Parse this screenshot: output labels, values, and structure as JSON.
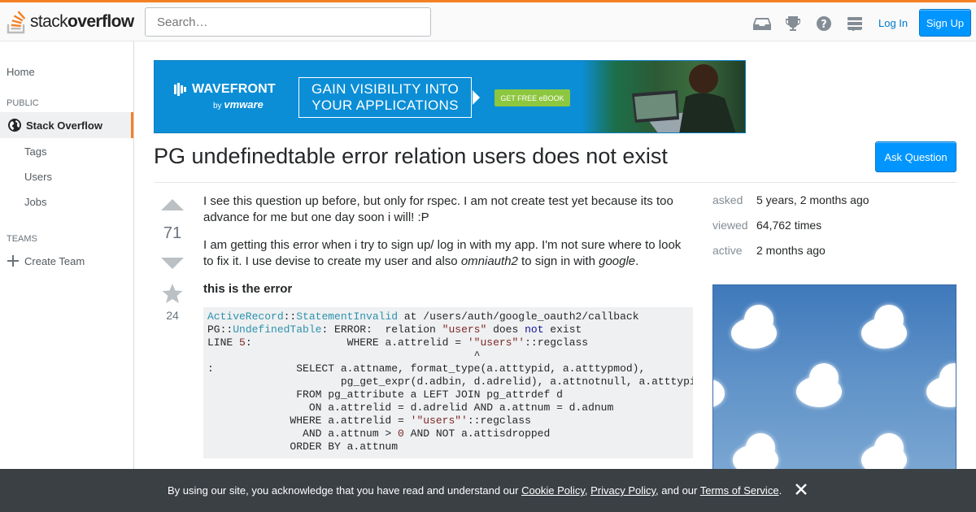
{
  "header": {
    "logo_prefix": "stack",
    "logo_suffix": "overflow",
    "search_placeholder": "Search…",
    "icons": [
      "inbox-icon",
      "trophy-icon",
      "help-icon",
      "stack-exchange-icon"
    ],
    "login_label": "Log In",
    "signup_label": "Sign Up",
    "accent_color": "#f48024",
    "button_color": "#0095ff"
  },
  "sidebar": {
    "home": "Home",
    "public_heading": "PUBLIC",
    "active_item": "Stack Overflow",
    "items": [
      {
        "label": "Tags"
      },
      {
        "label": "Users"
      },
      {
        "label": "Jobs"
      }
    ],
    "teams_heading": "TEAMS",
    "create_team": "Create Team"
  },
  "ad_banner": {
    "brand": "WAVEFRONT",
    "by": "by",
    "by_brand": "vmware",
    "headline_1": "GAIN VISIBILITY INTO",
    "headline_2": "YOUR APPLICATIONS",
    "cta": "GET FREE eBOOK"
  },
  "question": {
    "title": "PG undefinedtable error relation users does not exist",
    "ask_button": "Ask Question",
    "votes": "71",
    "favorites": "24",
    "paragraph_1": "I see this question up before, but only for rspec. I am not create test yet because its too advance for me but one day soon i will! :P",
    "paragraph_2_a": "I am getting this error when i try to sign up/ log in with my app. I'm not sure where to look to fix it. I use devise to create my user and also ",
    "paragraph_2_em1": "omniauth2",
    "paragraph_2_b": " to sign in with ",
    "paragraph_2_em2": "google",
    "paragraph_2_c": ".",
    "error_heading": "this is the error"
  },
  "code": {
    "l1_a": "ActiveRecord",
    "l1_b": "::",
    "l1_c": "StatementInvalid",
    "l1_d": " at /users/auth/google_oauth2/callback",
    "l2_a": "PG::",
    "l2_b": "UndefinedTable",
    "l2_c": ": ERROR:  relation ",
    "l2_d": "\"users\"",
    "l2_e": " does ",
    "l2_f": "not",
    "l2_g": " exist",
    "l3_a": "LINE ",
    "l3_b": "5",
    "l3_c": ":               WHERE a.attrelid = ",
    "l3_d": "'\"users\"'",
    "l3_e": "::regclass",
    "l4": "                                          ^",
    "l5": ":             SELECT a.attname, format_type(a.atttypid, a.atttypmod),",
    "l6": "                     pg_get_expr(d.adbin, d.adrelid), a.attnotnull, a.atttypid",
    "l7": "              FROM pg_attribute a LEFT JOIN pg_attrdef d",
    "l8": "                ON a.attrelid = d.adrelid AND a.attnum = d.adnum",
    "l9_a": "             WHERE a.attrelid = ",
    "l9_b": "'\"users\"'",
    "l9_c": "::regclass",
    "l10_a": "               AND a.attnum > ",
    "l10_b": "0",
    "l10_c": " AND NOT a.attisdropped",
    "l11": "             ORDER BY a.attnum"
  },
  "stats": {
    "asked_label": "asked",
    "asked_value": "5 years, 2 months ago",
    "viewed_label": "viewed",
    "viewed_value": "64,762 times",
    "active_label": "active",
    "active_value": "2 months ago"
  },
  "cookie_banner": {
    "text_a": "By using our site, you acknowledge that you have read and understand our ",
    "cookie_policy": "Cookie Policy",
    "sep_1": ", ",
    "privacy_policy": "Privacy Policy",
    "sep_2": ", and our ",
    "terms": "Terms of Service",
    "end": "."
  }
}
